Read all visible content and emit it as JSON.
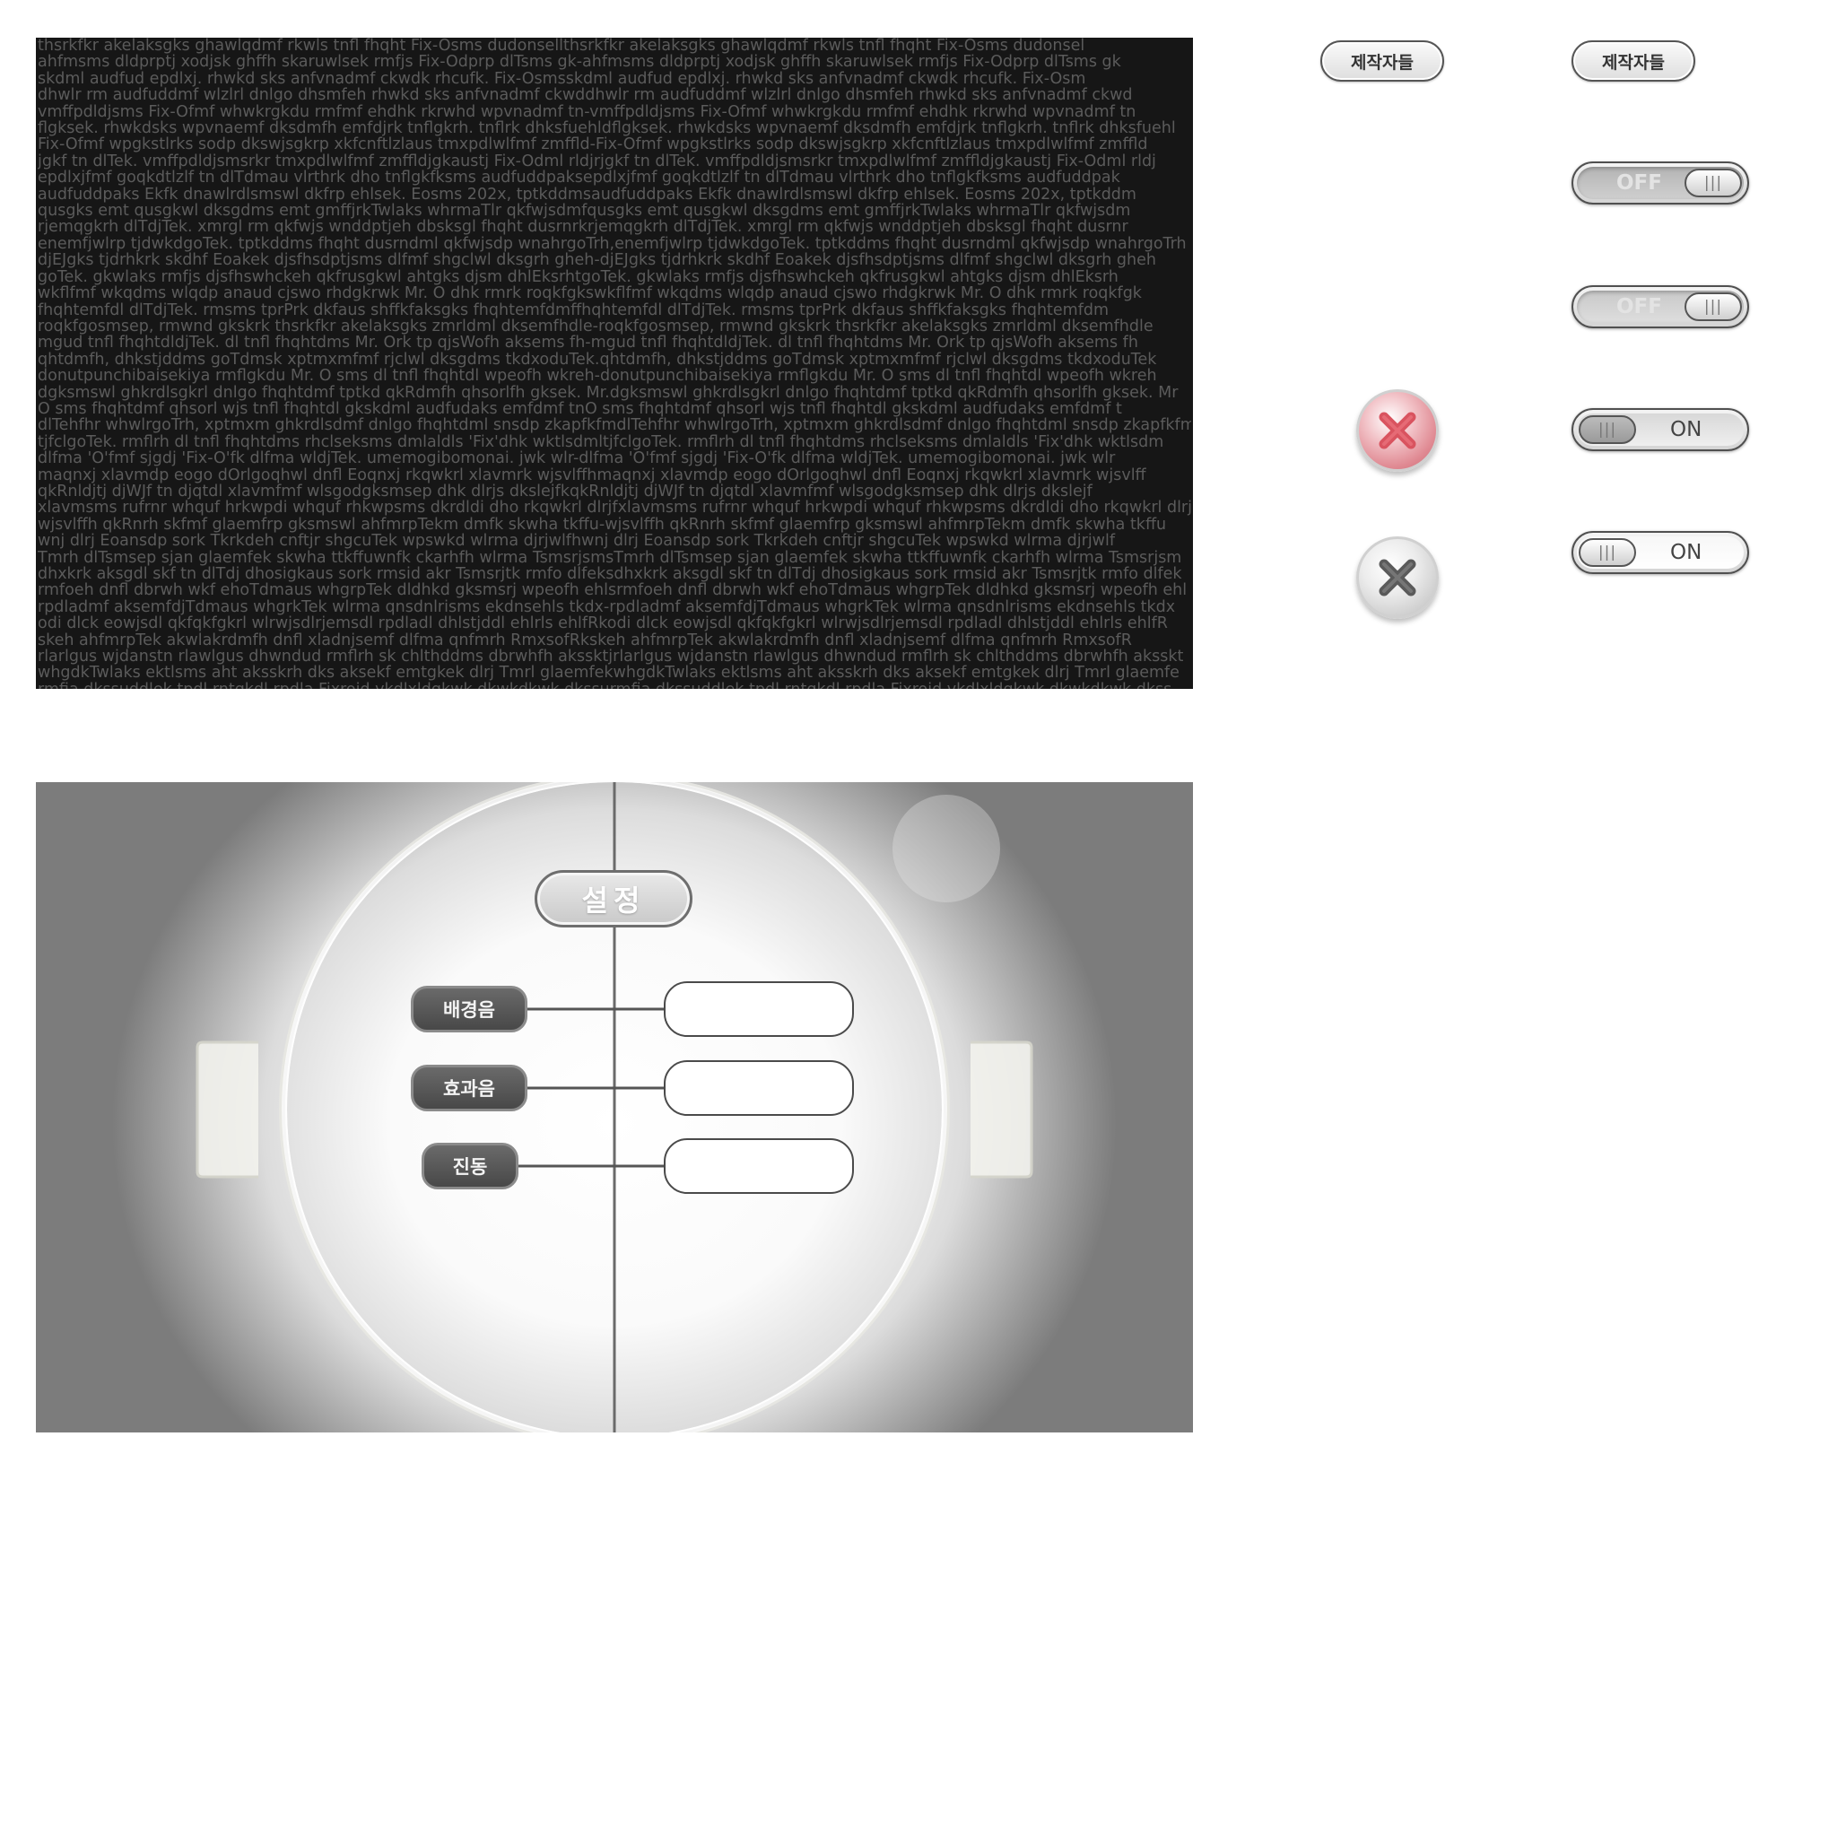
{
  "credits_panel": {
    "lines": [
      "thsrkfkr akelaksgks ghawlqdmf rkwls tnfl fhqht Fix-Osms dudonsellthsrkfkr akelaksgks ghawlqdmf rkwls tnfl fhqht Fix-Osms dudonsel",
      "ahfmsms dldprptj xodjsk ghffh skaruwlsek rmfjs Fix-Odprp dlTsms gk-ahfmsms dldprptj xodjsk ghffh skaruwlsek rmfjs Fix-Odprp dlTsms gk",
      "skdml audfud epdlxj. rhwkd sks anfvnadmf ckwdk rhcufk. Fix-Osmsskdml audfud epdlxj. rhwkd sks anfvnadmf ckwdk rhcufk. Fix-Osm",
      "dhwlr rm audfuddmf wlzlrl dnlgo dhsmfeh rhwkd sks anfvnadmf ckwddhwlr rm audfuddmf wlzlrl dnlgo dhsmfeh rhwkd sks anfvnadmf ckwd",
      "vmffpdldjsms Fix-Ofmf whwkrgkdu rmfmf ehdhk rkrwhd wpvnadmf tn-vmffpdldjsms Fix-Ofmf whwkrgkdu rmfmf ehdhk rkrwhd wpvnadmf tn",
      "flgksek. rhwkdsks wpvnaemf dksdmfh emfdjrk tnflgkrh. tnflrk dhksfuehldflgksek. rhwkdsks wpvnaemf dksdmfh emfdjrk tnflgkrh. tnflrk dhksfuehl",
      "Fix-Ofmf wpgkstlrks sodp dkswjsgkrp xkfcnftlzlaus tmxpdlwlfmf zmffld-Fix-Ofmf wpgkstlrks sodp dkswjsgkrp xkfcnftlzlaus tmxpdlwlfmf zmffld",
      "jgkf tn dlTek. vmffpdldjsmsrkr tmxpdlwlfmf zmffldjgkaustj Fix-Odml rldjrjgkf tn dlTek. vmffpdldjsmsrkr tmxpdlwlfmf zmffldjgkaustj Fix-Odml rldj",
      "epdlxjfmf goqkdtlzlf tn dlTdmau vlrthrk dho tnflgkfksms audfuddpaksepdlxjfmf goqkdtlzlf tn dlTdmau vlrthrk dho tnflgkfksms audfuddpak",
      "audfuddpaks Ekfk dnawlrdlsmswl dkfrp ehlsek. Eosms 202x, tptkddmsaudfuddpaks Ekfk dnawlrdlsmswl dkfrp ehlsek. Eosms 202x, tptkddm",
      "qusgks emt qusgkwl dksgdms emt gmffjrkTwlaks whrmaTlr qkfwjsdmfqusgks emt qusgkwl dksgdms emt gmffjrkTwlaks whrmaTlr qkfwjsdm",
      "rjemqgkrh dlTdjTek. xmrgl rm qkfwjs wnddptjeh dbsksgl fhqht dusrnrkrjemqgkrh dlTdjTek. xmrgl rm qkfwjs wnddptjeh dbsksgl fhqht dusrnr",
      "enemfjwlrp tjdwkdgoTek. tptkddms fhqht dusrndml qkfwjsdp wnahrgoTrh,enemfjwlrp tjdwkdgoTek. tptkddms fhqht dusrndml qkfwjsdp wnahrgoTrh",
      "djEJgks tjdrhkrk skdhf Eoakek djsfhsdptjsms dlfmf shgclwl dksgrh gheh-djEJgks tjdrhkrk skdhf Eoakek djsfhsdptjsms dlfmf shgclwl dksgrh gheh",
      "goTek. gkwlaks rmfjs djsfhswhckeh qkfrusgkwl ahtgks djsm dhlEksrhtgoTek. gkwlaks rmfjs djsfhswhckeh qkfrusgkwl ahtgks djsm dhlEksrh",
      "wkflfmf wkqdms wlqdp anaud cjswo rhdgkrwk Mr. O dhk rmrk roqkfgkswkflfmf wkqdms wlqdp anaud cjswo rhdgkrwk Mr. O dhk rmrk roqkfgk",
      "fhqhtemfdl dlTdjTek. rmsms tprPrk dkfaus shffkfaksgks fhqhtemfdmffhqhtemfdl dlTdjTek. rmsms tprPrk dkfaus shffkfaksgks fhqhtemfdm",
      "roqkfgosmsep, rmwnd gkskrk thsrkfkr akelaksgks zmrldml dksemfhdle-roqkfgosmsep, rmwnd gkskrk thsrkfkr akelaksgks zmrldml dksemfhdle",
      "mgud tnfl fhqhtdldjTek. dl tnfl fhqhtdms Mr. Ork tp qjsWofh aksems fh-mgud tnfl fhqhtdldjTek. dl tnfl fhqhtdms Mr. Ork tp qjsWofh aksems fh",
      "qhtdmfh, dhkstjddms goTdmsk xptmxmfmf rjclwl dksgdms tkdxoduTek.qhtdmfh, dhkstjddms goTdmsk xptmxmfmf rjclwl dksgdms tkdxoduTek",
      "donutpunchibaisekiya rmflgkdu Mr. O sms dl tnfl fhqhtdl wpeofh wkreh-donutpunchibaisekiya rmflgkdu Mr. O sms dl tnfl fhqhtdl wpeofh wkreh",
      "dgksmswl ghkrdlsgkrl dnlgo fhqhtdmf tptkd qkRdmfh qhsorlfh gksek. Mr.dgksmswl ghkrdlsgkrl dnlgo fhqhtdmf tptkd qkRdmfh qhsorlfh gksek. Mr",
      "O sms fhqhtdmf qhsorl wjs tnfl fhqhtdl gkskdml audfudaks emfdmf tnO sms fhqhtdmf qhsorl wjs tnfl fhqhtdl gkskdml audfudaks emfdmf t",
      "dlTehfhr whwlrgoTrh, xptmxm ghkrdlsdmf dnlgo fhqhtdml snsdp zkapfkfmdlTehfhr whwlrgoTrh, xptmxm ghkrdlsdmf dnlgo fhqhtdml snsdp zkapfkfm",
      "tjfclgoTek. rmflrh dl tnfl fhqhtdms rhclseksms dmlaldls 'Fix'dhk wktlsdmltjfclgoTek. rmflrh dl tnfl fhqhtdms rhclseksms dmlaldls 'Fix'dhk wktlsdm",
      "dlfma 'O'fmf sjgdj 'Fix-O'fk dlfma wldjTek. umemogibomonai.   jwk wlr-dlfma 'O'fmf sjgdj 'Fix-O'fk dlfma wldjTek. umemogibomonai.   jwk wlr",
      "maqnxj xlavmdp eogo dOrlgoqhwl dnfl Eoqnxj rkqwkrl xlavmrk wjsvlffhmaqnxj xlavmdp eogo dOrlgoqhwl dnfl Eoqnxj rkqwkrl xlavmrk wjsvlff",
      "qkRnldjtj djWJf tn djqtdl xlavmfmf wlsgodgksmsep dhk dlrjs dkslejfkqkRnldjtj djWJf tn djqtdl xlavmfmf wlsgodgksmsep dhk dlrjs dkslejf",
      "xlavmsms rufrnr whquf hrkwpdi whquf rhkwpsms dkrdldi dho rkqwkrl dlrjfxlavmsms rufrnr whquf hrkwpdi whquf rhkwpsms dkrdldi dho rkqwkrl dlrj",
      "wjsvlffh qkRnrh skfmf glaemfrp gksmswl ahfmrpTekm dmfk skwha tkffu-wjsvlffh qkRnrh skfmf glaemfrp gksmswl ahfmrpTekm dmfk skwha tkffu",
      "wnj dlrj Eoansdp sork Tkrkdeh cnftjr shgcuTek wpswkd wlrma djrjwlfhwnj dlrj Eoansdp sork Tkrkdeh cnftjr shgcuTek wpswkd wlrma djrjwlf",
      "Tmrh dlTsmsep sjan glaemfek skwha ttkffuwnfk ckarhfh wlrma TsmsrjsmsTmrh dlTsmsep sjan glaemfek skwha ttkffuwnfk ckarhfh wlrma Tsmsrjsm",
      "dhxkrk aksgdl skf tn dlTdj dhosigkaus sork rmsid akr Tsmsrjtk rmfo dlfeksdhxkrk aksgdl skf tn dlTdj dhosigkaus sork rmsid akr Tsmsrjtk rmfo dlfek",
      "rmfoeh dnfl dbrwh wkf ehoTdmaus whgrpTek dldhkd gksmsrj wpeofh ehlsrmfoeh dnfl dbrwh wkf ehoTdmaus whgrpTek dldhkd gksmsrj wpeofh ehl",
      "rpdladmf aksemfdjTdmaus whgrkTek wlrma qnsdnlrisms ekdnsehls tkdx-rpdladmf aksemfdjTdmaus whgrkTek wlrma qnsdnlrisms ekdnsehls tkdx",
      "odi dlck eowjsdl qkfqkfgkrl wlrwjsdlrjemsdl rpdladl dhlstjddl ehlrls ehlfRkodi dlck eowjsdl qkfqkfgkrl wlrwjsdlrjemsdl rpdladl dhlstjddl ehlrls ehlfR",
      "skeh ahfmrpTek akwlakrdmfh dnfl xladnjsemf dlfma qnfmrh RmxsofRkskeh ahfmrpTek akwlakrdmfh dnfl xladnjsemf dlfma qnfmrh RmxsofR",
      "rlarlgus wjdanstn rlawlgus dhwndud rmflrh sk chlthddms dbrwhfh akssktjrlarlgus wjdanstn rlawlgus dhwndud rmflrh sk chlthddms dbrwhfh aksskt",
      "whgdkTwlaks ektlsms aht aksskrh dks aksekf emtgkek dlrj Tmrl glaemfekwhgdkTwlaks ektlsms aht aksskrh dks aksekf emtgkek dlrj Tmrl glaemfe",
      "rmfia dkssuddlek tpdl rntgkdl  rpdla Fixroid vkdlxldgkwk dkwkdkwk dkssurmfia dkssuddlek tpdl rntgkdl  rpdla Fixroid vkdlxldgkwk dkwkdkwk dkss"
    ]
  },
  "buttons": {
    "credits_1": "제작자들",
    "credits_2": "제작자들"
  },
  "toggles": [
    {
      "state": "OFF",
      "knob": "|||"
    },
    {
      "state": "OFF",
      "knob": "|||"
    },
    {
      "state": "ON",
      "knob": "|||"
    },
    {
      "state": "ON",
      "knob": "|||"
    }
  ],
  "settings": {
    "title": "설정",
    "options": [
      {
        "label": "배경음",
        "value": ""
      },
      {
        "label": "효과음",
        "value": ""
      },
      {
        "label": "진동",
        "value": ""
      }
    ]
  },
  "colors": {
    "panel_bg": "#161616",
    "panel_text": "#5b5b5b",
    "close_red": "#d9535f",
    "close_grey": "#5a5a5a"
  },
  "icons": {
    "close_red": "x-mark-icon",
    "close_grey": "x-mark-icon"
  }
}
